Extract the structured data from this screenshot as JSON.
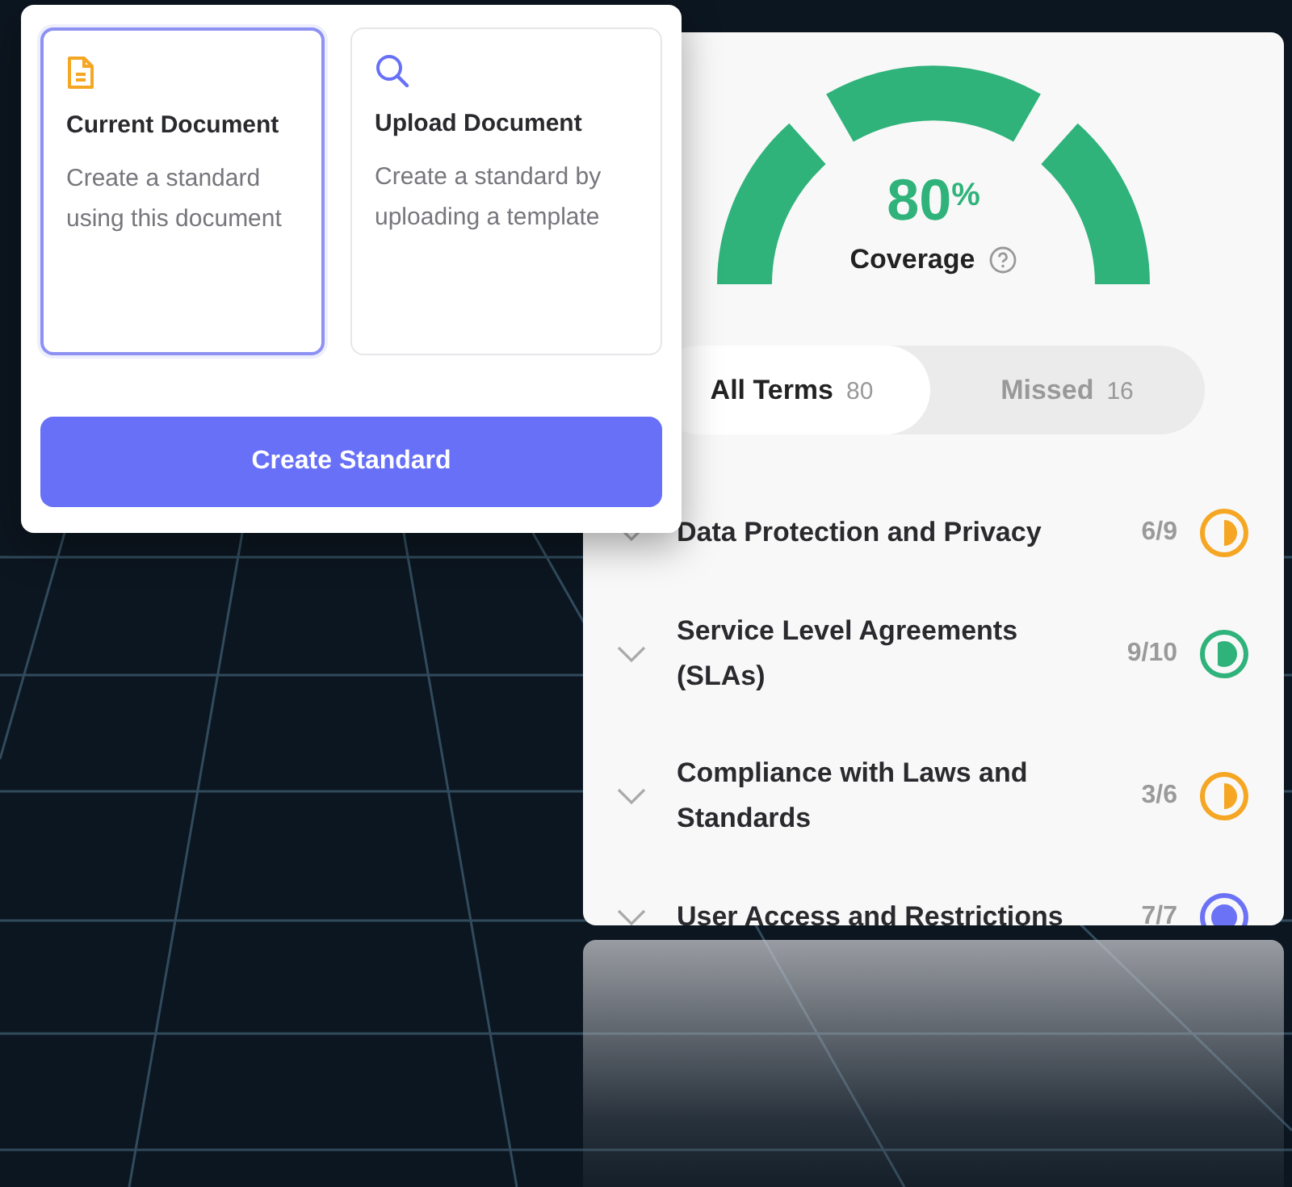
{
  "options": [
    {
      "kind": "document",
      "title": "Current Document",
      "description": "Create a standard using this document",
      "selected": true
    },
    {
      "kind": "search",
      "title": "Upload Document",
      "description": "Create a standard by uploading a template",
      "selected": false
    }
  ],
  "create_button": "Create Standard",
  "coverage": {
    "value": "80",
    "unit": "%",
    "label": "Coverage"
  },
  "tabs": [
    {
      "label": "All Terms",
      "count": "80",
      "selected": true
    },
    {
      "label": "Missed",
      "count": "16",
      "selected": false
    }
  ],
  "terms": [
    {
      "title": "Data Protection and Privacy",
      "score": "6/9",
      "level": 0.5,
      "color": "#f5a623"
    },
    {
      "title": "Service Level Agreements (SLAs)",
      "score": "9/10",
      "level": 0.75,
      "color": "#2fb37a"
    },
    {
      "title": "Compliance with Laws and Standards",
      "score": "3/6",
      "level": 0.5,
      "color": "#f5a623"
    },
    {
      "title": "User Access and Restrictions",
      "score": "7/7",
      "level": 1,
      "color": "#6b72f5"
    }
  ]
}
